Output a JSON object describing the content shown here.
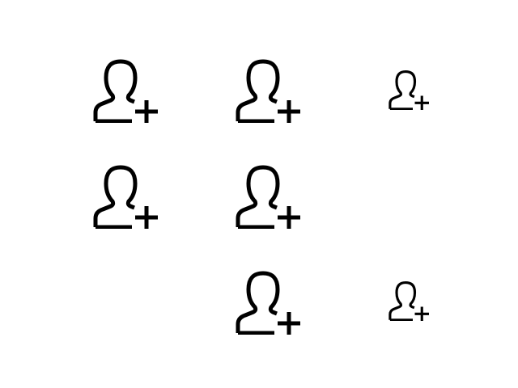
{
  "icon_set": {
    "icon": "add-user-icon",
    "color": "#000000",
    "background": "#ffffff",
    "grid": [
      [
        "add-user-icon",
        "add-user-icon",
        "add-user-icon"
      ],
      [
        "add-user-icon",
        "add-user-icon",
        ""
      ],
      [
        "",
        "add-user-icon",
        "add-user-icon"
      ]
    ]
  }
}
